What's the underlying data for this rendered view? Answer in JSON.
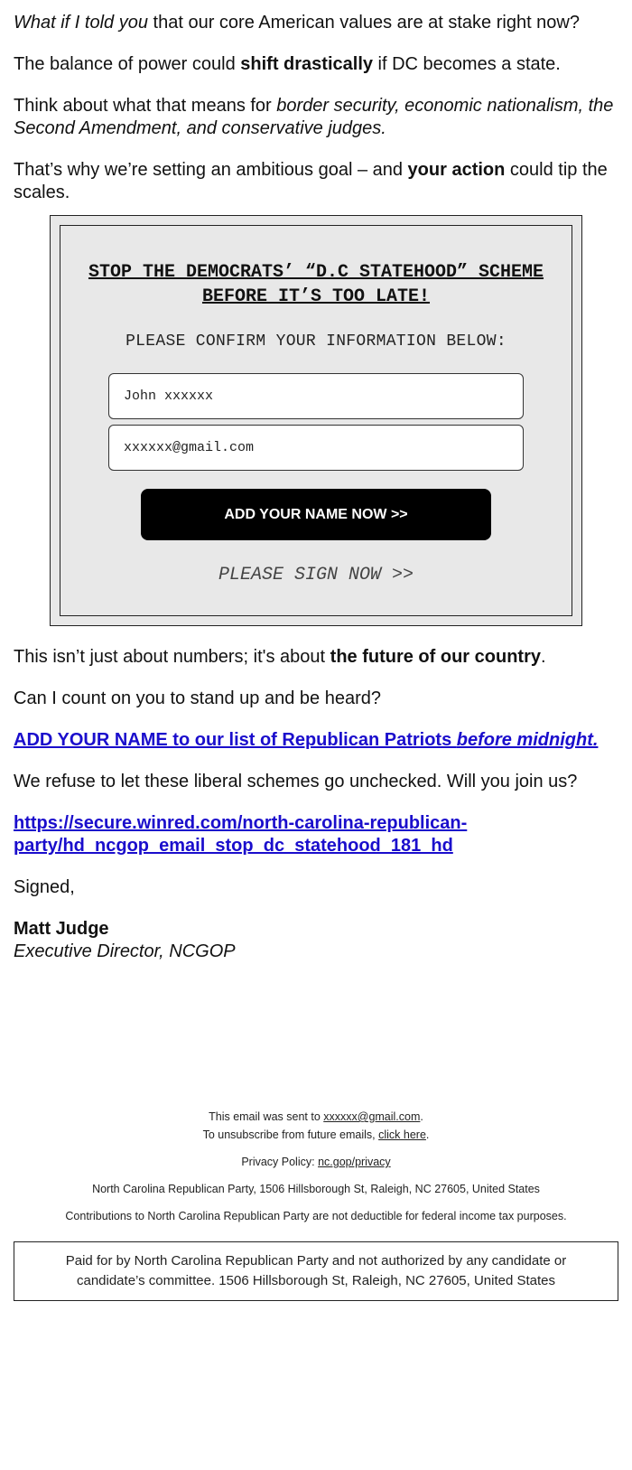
{
  "intro": {
    "p1_em": "What if I told you",
    "p1_rest": " that our core American values are at stake right now?",
    "p2_a": "The balance of power could ",
    "p2_b": "shift drastically",
    "p2_c": " if DC becomes a state.",
    "p3_a": "Think about what that means for ",
    "p3_em": "border security, economic nationalism, the Second Amendment, and conservative judges.",
    "p4_a": "That’s why we’re setting an ambitious goal – and ",
    "p4_b": "your action",
    "p4_c": " could tip the scales."
  },
  "form": {
    "title": "STOP THE DEMOCRATS’ “D.C STATEHOOD” SCHEME BEFORE IT’S TOO LATE!",
    "subtitle": "PLEASE CONFIRM YOUR INFORMATION BELOW:",
    "name_value": "John xxxxxx",
    "email_value": "xxxxxx@gmail.com",
    "button_label": "ADD YOUR NAME NOW >>",
    "sign_label": "PLEASE SIGN NOW >>"
  },
  "body": {
    "p5_a": "This isn’t just about numbers; it's about ",
    "p5_b": "the future of our country",
    "p5_c": ".",
    "p6": "Can I count on you to stand up and be heard?",
    "link1_a": "ADD YOUR NAME to our list of Republican Patriots ",
    "link1_em": "before midnight.",
    "p7": "We refuse to let these liberal schemes go unchecked. Will you join us?",
    "url": "https://secure.winred.com/north-carolina-republican-party/hd_ncgop_email_stop_dc_statehood_181_hd",
    "signed": "Signed,",
    "signer_name": "Matt Judge",
    "signer_title": "Executive Director, NCGOP"
  },
  "footer": {
    "sent_to_prefix": "This email was sent to ",
    "sent_to_email": "xxxxxx@gmail.com",
    "unsub_prefix": "To unsubscribe from future emails, ",
    "unsub_link": "click here",
    "privacy_prefix": "Privacy Policy: ",
    "privacy_link": "nc.gop/privacy",
    "address": "North Carolina Republican Party, 1506 Hillsborough St, Raleigh, NC 27605, United States",
    "contributions": "Contributions to North Carolina Republican Party are not deductible for federal income tax purposes.",
    "paid_for": "Paid for by North Carolina Republican Party and not authorized by any candidate or candidate’s committee. 1506 Hillsborough St, Raleigh, NC 27605, United States"
  },
  "colors": {
    "link": "#1a0dcc",
    "form_bg": "#e8e8e8",
    "button_bg": "#000000"
  }
}
